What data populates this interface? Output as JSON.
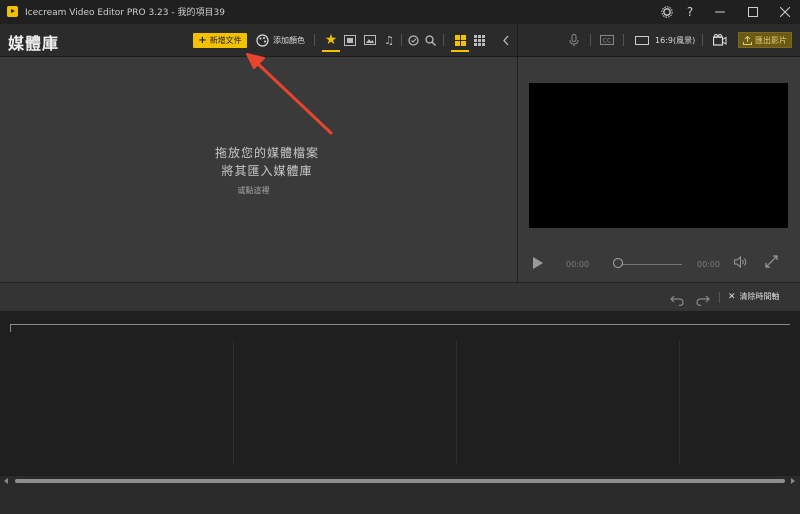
{
  "window": {
    "title": "Icecream Video Editor PRO 3.23  -  我的項目39",
    "settings_icon": "gear-icon",
    "help_label": "?",
    "minimize_icon": "minimize-icon",
    "maximize_icon": "maximize-icon",
    "close_icon": "close-icon"
  },
  "toolbar": {
    "library_title": "媒體庫",
    "add_file_label": "新增文件",
    "add_color_label": "添加顏色",
    "icons": [
      "palette-icon",
      "star-icon",
      "video-icon",
      "image-icon",
      "music-icon",
      "filter-icon",
      "search-icon",
      "grid-view-icon",
      "list-view-icon",
      "collapse-icon"
    ]
  },
  "library": {
    "drop_line1": "拖放您的媒體檔案",
    "drop_line2": "將其匯入媒體庫",
    "drop_line3": "或點這裡"
  },
  "preview": {
    "ratio_label": "16:9(風景)",
    "export_label": "匯出影片",
    "time_start": "00:00",
    "time_end": "00:00"
  },
  "timeline": {
    "clear_label": "清除時間軸"
  },
  "colors": {
    "accent": "#f2c200",
    "annotation_arrow": "#e8452c"
  }
}
